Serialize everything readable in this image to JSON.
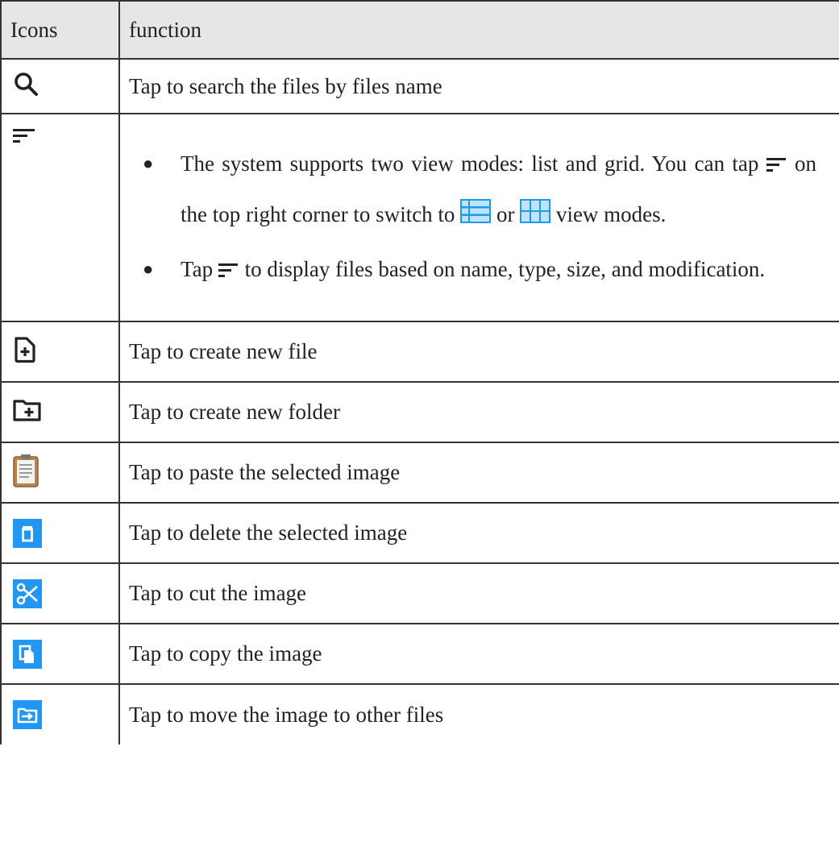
{
  "header": {
    "col_icons": "Icons",
    "col_function": "function"
  },
  "rows": [
    {
      "icon": "search-icon",
      "text": "Tap to search the files by files name"
    },
    {
      "icon": "sort-icon",
      "bullet1": {
        "a": "The system supports two view modes: list and grid. You can tap",
        "b": "on the top right corner to switch to",
        "c": "or",
        "d": "view modes."
      },
      "bullet2": {
        "a": "Tap",
        "b": "to display files based on name, type, size, and modification."
      }
    },
    {
      "icon": "new-file-icon",
      "text": "Tap to create new file"
    },
    {
      "icon": "new-folder-icon",
      "text": "Tap to create new folder"
    },
    {
      "icon": "clipboard-icon",
      "text": "Tap to paste the selected image"
    },
    {
      "icon": "trash-icon",
      "text": "Tap to delete the selected image"
    },
    {
      "icon": "scissors-icon",
      "text": "Tap to cut the image"
    },
    {
      "icon": "copy-icon",
      "text": "Tap to copy the image"
    },
    {
      "icon": "move-icon",
      "text": "Tap to move the image to other files"
    }
  ],
  "colors": {
    "header_bg": "#e6e6e6",
    "accent_blue": "#2196f3",
    "list_icon_blue": "#1e9be8"
  }
}
